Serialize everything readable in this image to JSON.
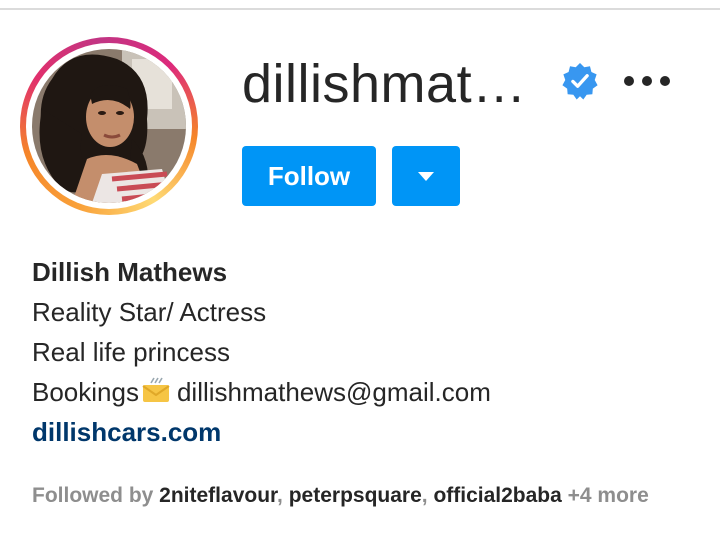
{
  "header": {
    "username": "dillishmat…",
    "verified_icon": "verified-badge-icon",
    "more_icon": "more-options-icon"
  },
  "actions": {
    "follow_label": "Follow",
    "dropdown_icon": "chevron-down-icon"
  },
  "colors": {
    "accent": "#0095f6",
    "link": "#00376b",
    "muted": "#8e8e8e",
    "text": "#262626"
  },
  "bio": {
    "full_name": "Dillish Mathews",
    "line1": "Reality Star/ Actress",
    "line2": "Real life princess",
    "bookings_label": "Bookings",
    "bookings_icon": "envelope-icon",
    "email": "dillishmathews@gmail.com",
    "website": "dillishcars.com"
  },
  "followed_by": {
    "prefix": "Followed by ",
    "accounts": [
      "2niteflavour",
      "peterpsquare",
      "official2baba"
    ],
    "separator": ", ",
    "more": " +4 more"
  }
}
